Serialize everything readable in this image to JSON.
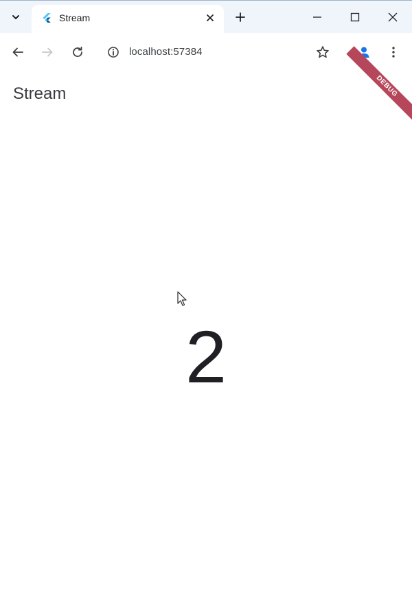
{
  "browser": {
    "tab": {
      "title": "Stream"
    },
    "address": {
      "url": "localhost:57384"
    }
  },
  "app": {
    "title": "Stream",
    "counter": "2",
    "debug_banner": "DEBUG"
  },
  "colors": {
    "tabstrip_bg": "#eff5fb",
    "profile_icon": "#1a73e8",
    "debug_banner": "#b6475b",
    "text_primary": "#1f1f24"
  }
}
